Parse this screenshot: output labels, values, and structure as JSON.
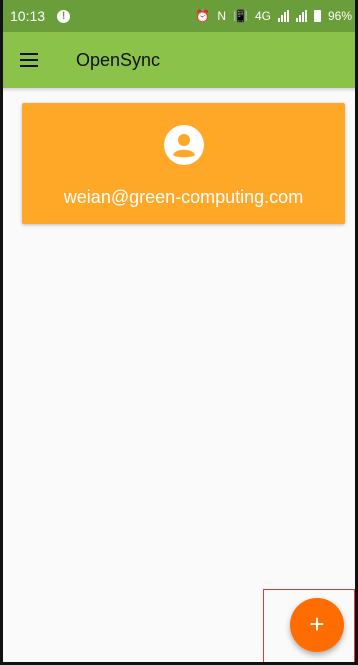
{
  "status_bar": {
    "time": "10:13",
    "alert_glyph": "!",
    "alarm_glyph": "⏰",
    "nfc_glyph": "N",
    "vibrate_glyph": "📳",
    "network_label": "4G",
    "battery_percent": "96%"
  },
  "app_bar": {
    "title": "OpenSync",
    "menu_icon": "hamburger-menu-icon"
  },
  "account": {
    "email": "weian@green-computing.com",
    "avatar_icon": "account-circle-icon"
  },
  "fab": {
    "label": "+",
    "icon": "add-icon"
  },
  "colors": {
    "status_bar": "#6a9e3a",
    "app_bar": "#8bc34a",
    "card": "#ffa726",
    "fab": "#ff6d00",
    "highlight": "#e53935"
  }
}
